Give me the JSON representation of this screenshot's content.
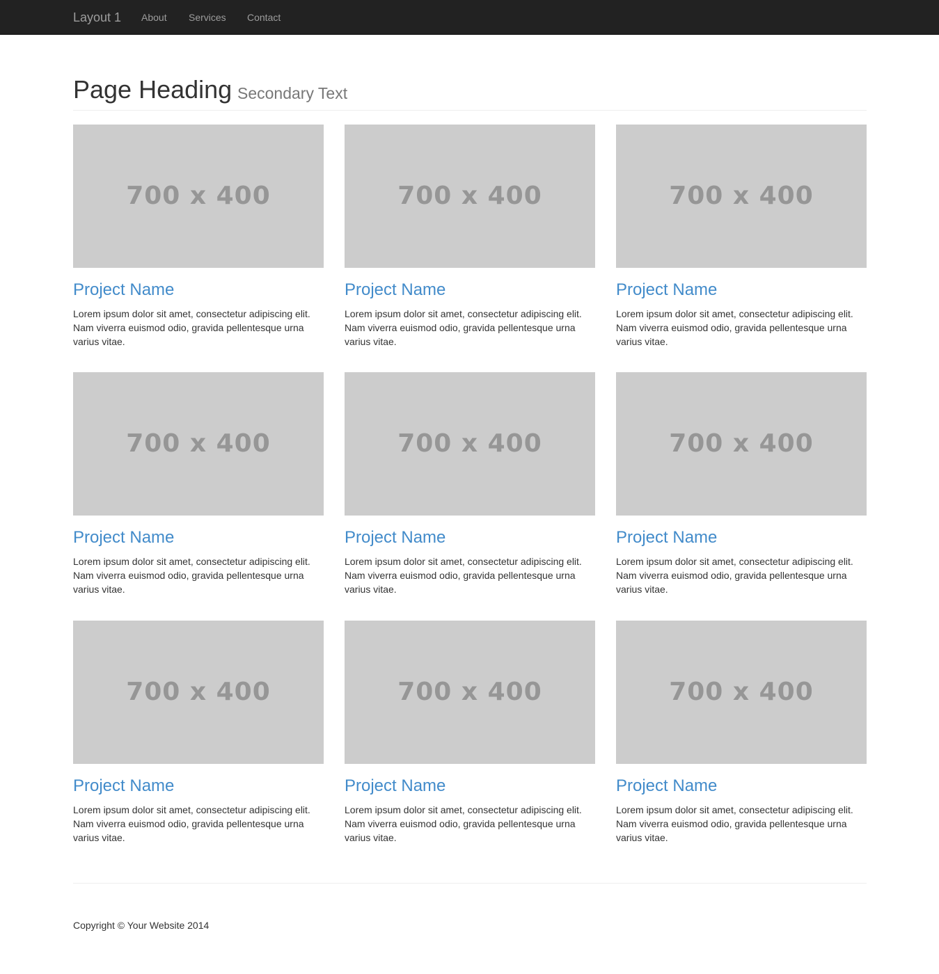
{
  "navbar": {
    "brand": "Layout 1",
    "links": [
      "About",
      "Services",
      "Contact"
    ]
  },
  "header": {
    "title": "Page Heading",
    "subtitle": "Secondary Text"
  },
  "projects": [
    {
      "image_label": "700 x 400",
      "title": "Project Name",
      "description": "Lorem ipsum dolor sit amet, consectetur adipiscing elit. Nam viverra euismod odio, gravida pellentesque urna varius vitae."
    },
    {
      "image_label": "700 x 400",
      "title": "Project Name",
      "description": "Lorem ipsum dolor sit amet, consectetur adipiscing elit. Nam viverra euismod odio, gravida pellentesque urna varius vitae."
    },
    {
      "image_label": "700 x 400",
      "title": "Project Name",
      "description": "Lorem ipsum dolor sit amet, consectetur adipiscing elit. Nam viverra euismod odio, gravida pellentesque urna varius vitae."
    },
    {
      "image_label": "700 x 400",
      "title": "Project Name",
      "description": "Lorem ipsum dolor sit amet, consectetur adipiscing elit. Nam viverra euismod odio, gravida pellentesque urna varius vitae."
    },
    {
      "image_label": "700 x 400",
      "title": "Project Name",
      "description": "Lorem ipsum dolor sit amet, consectetur adipiscing elit. Nam viverra euismod odio, gravida pellentesque urna varius vitae."
    },
    {
      "image_label": "700 x 400",
      "title": "Project Name",
      "description": "Lorem ipsum dolor sit amet, consectetur adipiscing elit. Nam viverra euismod odio, gravida pellentesque urna varius vitae."
    },
    {
      "image_label": "700 x 400",
      "title": "Project Name",
      "description": "Lorem ipsum dolor sit amet, consectetur adipiscing elit. Nam viverra euismod odio, gravida pellentesque urna varius vitae."
    },
    {
      "image_label": "700 x 400",
      "title": "Project Name",
      "description": "Lorem ipsum dolor sit amet, consectetur adipiscing elit. Nam viverra euismod odio, gravida pellentesque urna varius vitae."
    },
    {
      "image_label": "700 x 400",
      "title": "Project Name",
      "description": "Lorem ipsum dolor sit amet, consectetur adipiscing elit. Nam viverra euismod odio, gravida pellentesque urna varius vitae."
    }
  ],
  "footer": {
    "copyright": "Copyright © Your Website 2014"
  },
  "colors": {
    "navbar_bg": "#222222",
    "nav_text": "#9d9d9d",
    "link_blue": "#428bca",
    "placeholder_bg": "#cccccc",
    "placeholder_text": "#969696"
  }
}
